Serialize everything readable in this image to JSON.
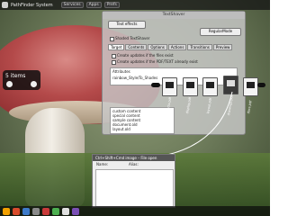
{
  "topbar": {
    "app_title": "PathFinder System",
    "buttons": [
      "Services",
      "Apps",
      "Prefs"
    ]
  },
  "selection_popup": {
    "label": "5 items"
  },
  "dialog": {
    "title": "TextShaver",
    "header_label": "Text effects",
    "dropdown_value": "RegularMode",
    "section_title": "Shaded TextShaver",
    "tabs": [
      "Target",
      "Contents",
      "Options",
      "Actions",
      "Transitions",
      "Preview"
    ],
    "option_rows": [
      "Create updates if the files exist",
      "Create updates if the PDF/TEXT already exist"
    ],
    "box_lines": [
      "Attributes",
      "rainbow_Style/To_Shades"
    ],
    "list_lines": [
      "custom content",
      "special content",
      "sample content",
      "document.old",
      "layout.old"
    ]
  },
  "shelf": {
    "files": [
      {
        "label": "effects.pdf",
        "dark": false
      },
      {
        "label": "display.pdf",
        "dark": false
      },
      {
        "label": "layout.pdf",
        "dark": false
      },
      {
        "label": "drawings.pdf",
        "dark": true
      },
      {
        "label": "docs.pdf",
        "dark": false
      }
    ]
  },
  "lower_window": {
    "title": "Ctrl+Shift+Cmd image – File open",
    "lines": [
      "Name:",
      "Alias:"
    ]
  },
  "dock": {
    "icon_colors": [
      "#f2a000",
      "#d94c2c",
      "#3d7ac9",
      "#8a8a8a",
      "#c93a3a",
      "#4caf50",
      "#e0e0e0",
      "#7a4fb5"
    ]
  }
}
